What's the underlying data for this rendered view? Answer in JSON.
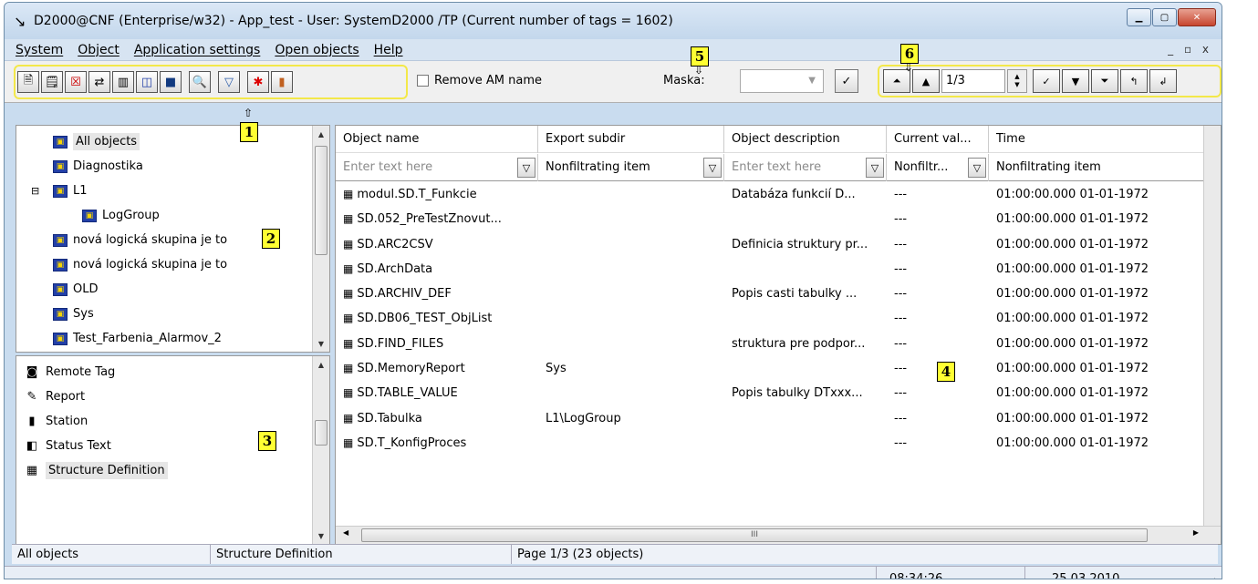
{
  "window": {
    "title": "D2000@CNF (Enterprise/w32) - App_test -  User: SystemD2000 /TP  (Current number of tags =  1602)",
    "controls": [
      "minimize",
      "maximize",
      "close"
    ]
  },
  "menu": {
    "items": [
      "System",
      "Object",
      "Application settings",
      "Open objects",
      "Help"
    ],
    "mdi_controls": "_ ▫ x"
  },
  "toolbar": {
    "buttons": [
      {
        "name": "new-object-button",
        "glyph": "🗎"
      },
      {
        "name": "properties-button",
        "glyph": "🗒"
      },
      {
        "name": "delete-object-button",
        "glyph": "☒"
      },
      {
        "name": "copy-object-button",
        "glyph": "⇄"
      },
      {
        "name": "move-object-button",
        "glyph": "▥"
      },
      {
        "name": "logical-group-button",
        "glyph": "◫"
      },
      {
        "name": "export-button",
        "glyph": "■"
      },
      {
        "name": "find-button",
        "glyph": "🔍"
      },
      {
        "name": "filter-button",
        "glyph": "▽"
      },
      {
        "name": "asterisk-button",
        "glyph": "✱"
      },
      {
        "name": "import-button",
        "glyph": "▮"
      }
    ],
    "remove_am_label": "Remove AM name",
    "maska_label": "Maska:",
    "maska_value": "",
    "page_value": "1/3"
  },
  "badges": [
    "1",
    "2",
    "3",
    "4",
    "5",
    "6"
  ],
  "tree": {
    "items": [
      {
        "label": "All objects",
        "indent": 0
      },
      {
        "label": "Diagnostika",
        "indent": 0
      },
      {
        "label": "L1",
        "indent": 0,
        "expanded": true
      },
      {
        "label": "LogGroup",
        "indent": 1
      },
      {
        "label": "nová logická skupina je to",
        "indent": 0
      },
      {
        "label": "nová logická skupina je to",
        "indent": 0
      },
      {
        "label": "OLD",
        "indent": 0
      },
      {
        "label": "Sys",
        "indent": 0
      },
      {
        "label": "Test_Farbenia_Alarmov_2",
        "indent": 0
      }
    ]
  },
  "types": {
    "items": [
      {
        "label": "Remote Tag",
        "icon": "◙"
      },
      {
        "label": "Report",
        "icon": "✎"
      },
      {
        "label": "Station",
        "icon": "▮"
      },
      {
        "label": "Status Text",
        "icon": "◧"
      },
      {
        "label": "Structure Definition",
        "icon": "▦"
      }
    ]
  },
  "grid": {
    "columns": [
      {
        "label": "Object name"
      },
      {
        "label": "Export subdir"
      },
      {
        "label": "Object description"
      },
      {
        "label": "Current val..."
      },
      {
        "label": "Time"
      }
    ],
    "filters": [
      {
        "text": "Enter text here",
        "placeholder": true
      },
      {
        "text": "Nonfiltrating item",
        "placeholder": false
      },
      {
        "text": "Enter text here",
        "placeholder": true
      },
      {
        "text": "Nonfiltr...",
        "placeholder": false
      },
      {
        "text": "Nonfiltrating item",
        "placeholder": false
      }
    ],
    "rows": [
      [
        "modul.SD.T_Funkcie",
        "",
        "Databáza funkcií D...",
        "---",
        "01:00:00.000 01-01-1972"
      ],
      [
        "SD.052_PreTestZnovut...",
        "",
        "",
        "---",
        "01:00:00.000 01-01-1972"
      ],
      [
        "SD.ARC2CSV",
        "",
        "Definicia struktury pr...",
        "---",
        "01:00:00.000 01-01-1972"
      ],
      [
        "SD.ArchData",
        "",
        "",
        "---",
        "01:00:00.000 01-01-1972"
      ],
      [
        "SD.ARCHIV_DEF",
        "",
        "Popis casti tabulky ...",
        "---",
        "01:00:00.000 01-01-1972"
      ],
      [
        "SD.DB06_TEST_ObjList",
        "",
        "",
        "---",
        "01:00:00.000 01-01-1972"
      ],
      [
        "SD.FIND_FILES",
        "",
        "struktura pre podpor...",
        "---",
        "01:00:00.000 01-01-1972"
      ],
      [
        "SD.MemoryReport",
        "Sys",
        "",
        "---",
        "01:00:00.000 01-01-1972"
      ],
      [
        "SD.TABLE_VALUE",
        "",
        "Popis tabulky DTxxx...",
        "---",
        "01:00:00.000 01-01-1972"
      ],
      [
        "SD.Tabulka",
        "L1\\LogGroup",
        "",
        "---",
        "01:00:00.000 01-01-1972"
      ],
      [
        "SD.T_KonfigProces",
        "",
        "",
        "---",
        "01:00:00.000 01-01-1972"
      ]
    ]
  },
  "status": {
    "group": "All objects",
    "type": "Structure Definition",
    "page": "Page  1/3  (23 objects)",
    "time": "08:34:26",
    "date": "25.03.2010"
  }
}
